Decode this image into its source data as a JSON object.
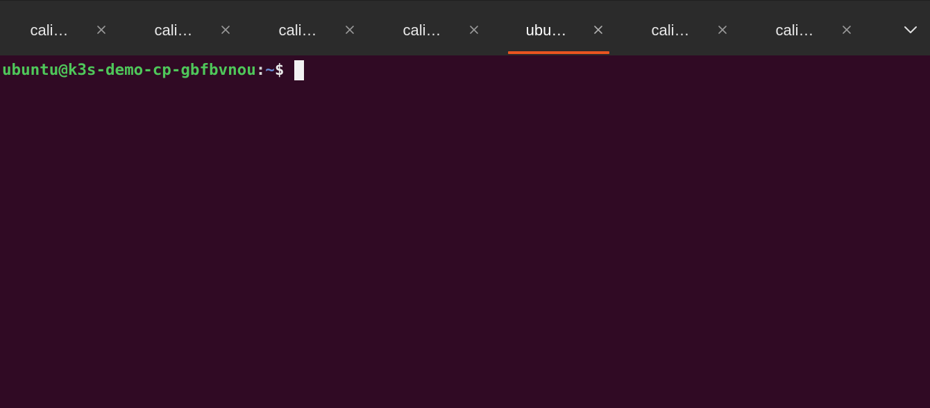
{
  "tabs": [
    {
      "label": "cali…",
      "active": false
    },
    {
      "label": "cali…",
      "active": false
    },
    {
      "label": "cali…",
      "active": false
    },
    {
      "label": "cali…",
      "active": false
    },
    {
      "label": "ubu…",
      "active": true
    },
    {
      "label": "cali…",
      "active": false
    },
    {
      "label": "cali…",
      "active": false
    }
  ],
  "tab_close_icon": "close-x-icon",
  "tabs_menu_icon": "chevron-down-icon",
  "terminal": {
    "prompt_user_host": "ubuntu@k3s-demo-cp-gbfbvnou",
    "prompt_separator": ":",
    "prompt_path": "~",
    "prompt_symbol": "$"
  },
  "colors": {
    "terminal_background": "#300a24",
    "tab_bar_background": "#2b2b2b",
    "active_tab_indicator": "#e95420",
    "prompt_user_host": "#4fc75a",
    "prompt_path": "#6a8fd8"
  }
}
